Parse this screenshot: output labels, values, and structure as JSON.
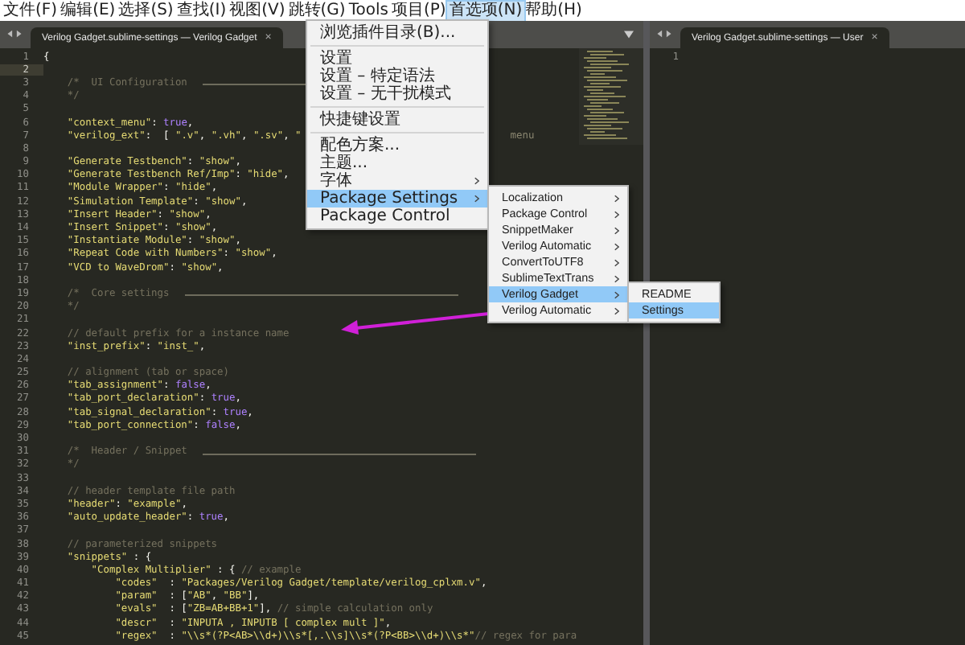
{
  "menu_bar": [
    {
      "label": "文件(F)",
      "selected": false
    },
    {
      "label": "编辑(E)",
      "selected": false
    },
    {
      "label": "选择(S)",
      "selected": false
    },
    {
      "label": "查找(I)",
      "selected": false
    },
    {
      "label": "视图(V)",
      "selected": false
    },
    {
      "label": "跳转(G)",
      "selected": false
    },
    {
      "label": "Tools",
      "selected": false
    },
    {
      "label": "项目(P)",
      "selected": false
    },
    {
      "label": "首选项(N)",
      "selected": true
    },
    {
      "label": "帮助(H)",
      "selected": false
    }
  ],
  "left_pane": {
    "tab": "Verilog Gadget.sublime-settings — Verilog Gadget",
    "close": "×",
    "lines": [
      {
        "no": "1",
        "current": false,
        "rule": false,
        "tokens": [
          {
            "kind": "pun",
            "text": "{"
          }
        ]
      },
      {
        "no": "2",
        "current": true,
        "rule": false
      },
      {
        "no": "3",
        "current": false,
        "rule": true,
        "tokens": [
          {
            "kind": "com",
            "text": "    /*  UI Configuration"
          }
        ]
      },
      {
        "no": "4",
        "current": false,
        "rule": false,
        "tokens": [
          {
            "kind": "com",
            "text": "    */"
          }
        ]
      },
      {
        "no": "5",
        "current": false,
        "rule": false
      },
      {
        "no": "6",
        "current": false,
        "rule": false,
        "tokens": [
          {
            "kind": "str",
            "text": "    \"context_menu\""
          },
          {
            "kind": "pun",
            "text": ": "
          },
          {
            "kind": "bool",
            "text": "true"
          },
          {
            "kind": "pun",
            "text": ","
          }
        ]
      },
      {
        "no": "7",
        "current": false,
        "rule": false,
        "tokens": [
          {
            "kind": "str",
            "text": "    \"verilog_ext\""
          },
          {
            "kind": "pun",
            "text": ":  [ "
          },
          {
            "kind": "str",
            "text": "\".v\""
          },
          {
            "kind": "pun",
            "text": ", "
          },
          {
            "kind": "str",
            "text": "\".vh\""
          },
          {
            "kind": "pun",
            "text": ", "
          },
          {
            "kind": "str",
            "text": "\".sv\""
          },
          {
            "kind": "pun",
            "text": ", "
          },
          {
            "kind": "str",
            "text": "\""
          },
          {
            "kind": "tail",
            "text": "menu"
          }
        ]
      },
      {
        "no": "8",
        "current": false,
        "rule": false
      },
      {
        "no": "9",
        "current": false,
        "rule": false,
        "tokens": [
          {
            "kind": "str",
            "text": "    \"Generate Testbench\""
          },
          {
            "kind": "pun",
            "text": ": "
          },
          {
            "kind": "str",
            "text": "\"show\""
          },
          {
            "kind": "pun",
            "text": ","
          }
        ]
      },
      {
        "no": "10",
        "current": false,
        "rule": false,
        "tokens": [
          {
            "kind": "str",
            "text": "    \"Generate Testbench Ref/Imp\""
          },
          {
            "kind": "pun",
            "text": ": "
          },
          {
            "kind": "str",
            "text": "\"hide\""
          },
          {
            "kind": "pun",
            "text": ","
          }
        ]
      },
      {
        "no": "11",
        "current": false,
        "rule": false,
        "tokens": [
          {
            "kind": "str",
            "text": "    \"Module Wrapper\""
          },
          {
            "kind": "pun",
            "text": ": "
          },
          {
            "kind": "str",
            "text": "\"hide\""
          },
          {
            "kind": "pun",
            "text": ","
          }
        ]
      },
      {
        "no": "12",
        "current": false,
        "rule": false,
        "tokens": [
          {
            "kind": "str",
            "text": "    \"Simulation Template\""
          },
          {
            "kind": "pun",
            "text": ": "
          },
          {
            "kind": "str",
            "text": "\"show\""
          },
          {
            "kind": "pun",
            "text": ","
          }
        ]
      },
      {
        "no": "13",
        "current": false,
        "rule": false,
        "tokens": [
          {
            "kind": "str",
            "text": "    \"Insert Header\""
          },
          {
            "kind": "pun",
            "text": ": "
          },
          {
            "kind": "str",
            "text": "\"show\""
          },
          {
            "kind": "pun",
            "text": ","
          }
        ]
      },
      {
        "no": "14",
        "current": false,
        "rule": false,
        "tokens": [
          {
            "kind": "str",
            "text": "    \"Insert Snippet\""
          },
          {
            "kind": "pun",
            "text": ": "
          },
          {
            "kind": "str",
            "text": "\"show\""
          },
          {
            "kind": "pun",
            "text": ","
          }
        ]
      },
      {
        "no": "15",
        "current": false,
        "rule": false,
        "tokens": [
          {
            "kind": "str",
            "text": "    \"Instantiate Module\""
          },
          {
            "kind": "pun",
            "text": ": "
          },
          {
            "kind": "str",
            "text": "\"show\""
          },
          {
            "kind": "pun",
            "text": ","
          }
        ]
      },
      {
        "no": "16",
        "current": false,
        "rule": false,
        "tokens": [
          {
            "kind": "str",
            "text": "    \"Repeat Code with Numbers\""
          },
          {
            "kind": "pun",
            "text": ": "
          },
          {
            "kind": "str",
            "text": "\"show\""
          },
          {
            "kind": "pun",
            "text": ","
          }
        ]
      },
      {
        "no": "17",
        "current": false,
        "rule": false,
        "tokens": [
          {
            "kind": "str",
            "text": "    \"VCD to WaveDrom\""
          },
          {
            "kind": "pun",
            "text": ": "
          },
          {
            "kind": "str",
            "text": "\"show\""
          },
          {
            "kind": "pun",
            "text": ","
          }
        ]
      },
      {
        "no": "18",
        "current": false,
        "rule": false
      },
      {
        "no": "19",
        "current": false,
        "rule": true,
        "tokens": [
          {
            "kind": "com",
            "text": "    /*  Core settings"
          }
        ]
      },
      {
        "no": "20",
        "current": false,
        "rule": false,
        "tokens": [
          {
            "kind": "com",
            "text": "    */"
          }
        ]
      },
      {
        "no": "21",
        "current": false,
        "rule": false
      },
      {
        "no": "22",
        "current": false,
        "rule": false,
        "tokens": [
          {
            "kind": "com",
            "text": "    // default prefix for a instance name"
          }
        ]
      },
      {
        "no": "23",
        "current": false,
        "rule": false,
        "tokens": [
          {
            "kind": "str",
            "text": "    \"inst_prefix\""
          },
          {
            "kind": "pun",
            "text": ": "
          },
          {
            "kind": "str",
            "text": "\"inst_\""
          },
          {
            "kind": "pun",
            "text": ","
          }
        ]
      },
      {
        "no": "24",
        "current": false,
        "rule": false
      },
      {
        "no": "25",
        "current": false,
        "rule": false,
        "tokens": [
          {
            "kind": "com",
            "text": "    // alignment (tab or space)"
          }
        ]
      },
      {
        "no": "26",
        "current": false,
        "rule": false,
        "tokens": [
          {
            "kind": "str",
            "text": "    \"tab_assignment\""
          },
          {
            "kind": "pun",
            "text": ": "
          },
          {
            "kind": "bool",
            "text": "false"
          },
          {
            "kind": "pun",
            "text": ","
          }
        ]
      },
      {
        "no": "27",
        "current": false,
        "rule": false,
        "tokens": [
          {
            "kind": "str",
            "text": "    \"tab_port_declaration\""
          },
          {
            "kind": "pun",
            "text": ": "
          },
          {
            "kind": "bool",
            "text": "true"
          },
          {
            "kind": "pun",
            "text": ","
          }
        ]
      },
      {
        "no": "28",
        "current": false,
        "rule": false,
        "tokens": [
          {
            "kind": "str",
            "text": "    \"tab_signal_declaration\""
          },
          {
            "kind": "pun",
            "text": ": "
          },
          {
            "kind": "bool",
            "text": "true"
          },
          {
            "kind": "pun",
            "text": ","
          }
        ]
      },
      {
        "no": "29",
        "current": false,
        "rule": false,
        "tokens": [
          {
            "kind": "str",
            "text": "    \"tab_port_connection\""
          },
          {
            "kind": "pun",
            "text": ": "
          },
          {
            "kind": "bool",
            "text": "false"
          },
          {
            "kind": "pun",
            "text": ","
          }
        ]
      },
      {
        "no": "30",
        "current": false,
        "rule": false
      },
      {
        "no": "31",
        "current": false,
        "rule": true,
        "tokens": [
          {
            "kind": "com",
            "text": "    /*  Header / Snippet"
          }
        ]
      },
      {
        "no": "32",
        "current": false,
        "rule": false,
        "tokens": [
          {
            "kind": "com",
            "text": "    */"
          }
        ]
      },
      {
        "no": "33",
        "current": false,
        "rule": false
      },
      {
        "no": "34",
        "current": false,
        "rule": false,
        "tokens": [
          {
            "kind": "com",
            "text": "    // header template file path"
          }
        ]
      },
      {
        "no": "35",
        "current": false,
        "rule": false,
        "tokens": [
          {
            "kind": "str",
            "text": "    \"header\""
          },
          {
            "kind": "pun",
            "text": ": "
          },
          {
            "kind": "str",
            "text": "\"example\""
          },
          {
            "kind": "pun",
            "text": ","
          }
        ]
      },
      {
        "no": "36",
        "current": false,
        "rule": false,
        "tokens": [
          {
            "kind": "str",
            "text": "    \"auto_update_header\""
          },
          {
            "kind": "pun",
            "text": ": "
          },
          {
            "kind": "bool",
            "text": "true"
          },
          {
            "kind": "pun",
            "text": ","
          }
        ]
      },
      {
        "no": "37",
        "current": false,
        "rule": false
      },
      {
        "no": "38",
        "current": false,
        "rule": false,
        "tokens": [
          {
            "kind": "com",
            "text": "    // parameterized snippets"
          }
        ]
      },
      {
        "no": "39",
        "current": false,
        "rule": false,
        "tokens": [
          {
            "kind": "str",
            "text": "    \"snippets\""
          },
          {
            "kind": "pun",
            "text": " : {"
          }
        ]
      },
      {
        "no": "40",
        "current": false,
        "rule": false,
        "tokens": [
          {
            "kind": "str",
            "text": "        \"Complex Multiplier\""
          },
          {
            "kind": "pun",
            "text": " : { "
          },
          {
            "kind": "com",
            "text": "// example"
          }
        ]
      },
      {
        "no": "41",
        "current": false,
        "rule": false,
        "tokens": [
          {
            "kind": "str",
            "text": "            \"codes\""
          },
          {
            "kind": "pun",
            "text": "  : "
          },
          {
            "kind": "str",
            "text": "\"Packages/Verilog Gadget/template/verilog_cplxm.v\""
          },
          {
            "kind": "pun",
            "text": ","
          }
        ]
      },
      {
        "no": "42",
        "current": false,
        "rule": false,
        "tokens": [
          {
            "kind": "str",
            "text": "            \"param\""
          },
          {
            "kind": "pun",
            "text": "  : ["
          },
          {
            "kind": "str",
            "text": "\"AB\""
          },
          {
            "kind": "pun",
            "text": ", "
          },
          {
            "kind": "str",
            "text": "\"BB\""
          },
          {
            "kind": "pun",
            "text": "],"
          }
        ]
      },
      {
        "no": "43",
        "current": false,
        "rule": false,
        "tokens": [
          {
            "kind": "str",
            "text": "            \"evals\""
          },
          {
            "kind": "pun",
            "text": "  : ["
          },
          {
            "kind": "str",
            "text": "\"ZB=AB+BB+1\""
          },
          {
            "kind": "pun",
            "text": "], "
          },
          {
            "kind": "com",
            "text": "// simple calculation only"
          }
        ]
      },
      {
        "no": "44",
        "current": false,
        "rule": false,
        "tokens": [
          {
            "kind": "str",
            "text": "            \"descr\""
          },
          {
            "kind": "pun",
            "text": "  : "
          },
          {
            "kind": "str",
            "text": "\"INPUTA , INPUTB [ complex mult ]\""
          },
          {
            "kind": "pun",
            "text": ","
          }
        ]
      },
      {
        "no": "45",
        "current": false,
        "rule": false,
        "tokens": [
          {
            "kind": "str",
            "text": "            \"regex\""
          },
          {
            "kind": "pun",
            "text": "  : "
          },
          {
            "kind": "str",
            "text": "\"\\\\s*(?P<AB>\\\\d+)\\\\s*[,.\\\\s]\\\\s*(?P<BB>\\\\d+)\\\\s*\""
          },
          {
            "kind": "com",
            "text": "// regex for para"
          }
        ]
      }
    ]
  },
  "right_pane": {
    "tab": "Verilog Gadget.sublime-settings — User",
    "close": "×",
    "lines": [
      {
        "no": "1"
      }
    ]
  },
  "preferences_menu": [
    {
      "label": "浏览插件目录(B)...",
      "selected": false,
      "submenu": false,
      "separator_after": true
    },
    {
      "label": "设置",
      "selected": false,
      "submenu": false,
      "separator_after": false
    },
    {
      "label": "设置 – 特定语法",
      "selected": false,
      "submenu": false,
      "separator_after": false
    },
    {
      "label": "设置 – 无干扰模式",
      "selected": false,
      "submenu": false,
      "separator_after": true
    },
    {
      "label": "快捷键设置",
      "selected": false,
      "submenu": false,
      "separator_after": true
    },
    {
      "label": "配色方案...",
      "selected": false,
      "submenu": false,
      "separator_after": false
    },
    {
      "label": "主题...",
      "selected": false,
      "submenu": false,
      "separator_after": false
    },
    {
      "label": "字体",
      "selected": false,
      "submenu": true,
      "separator_after": false
    },
    {
      "label": "Package Settings",
      "selected": true,
      "submenu": true,
      "separator_after": false,
      "children": [
        {
          "label": "Localization",
          "selected": false,
          "submenu": true
        },
        {
          "label": "Package Control",
          "selected": false,
          "submenu": true
        },
        {
          "label": "SnippetMaker",
          "selected": false,
          "submenu": true
        },
        {
          "label": "Verilog Automatic",
          "selected": false,
          "submenu": true
        },
        {
          "label": "ConvertToUTF8",
          "selected": false,
          "submenu": true
        },
        {
          "label": "SublimeTextTrans",
          "selected": false,
          "submenu": true
        },
        {
          "label": "Verilog Gadget",
          "selected": true,
          "submenu": true,
          "children": [
            {
              "label": "README",
              "selected": false,
              "submenu": false
            },
            {
              "label": "Settings",
              "selected": true,
              "submenu": false
            }
          ]
        },
        {
          "label": "Verilog Automatic",
          "selected": false,
          "submenu": true
        }
      ]
    },
    {
      "label": "Package Control",
      "selected": false,
      "submenu": false,
      "separator_after": false
    }
  ]
}
